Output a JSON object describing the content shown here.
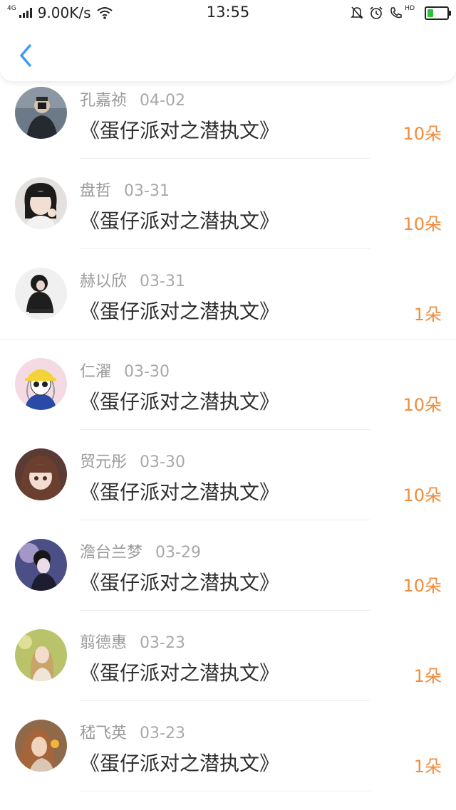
{
  "status_bar": {
    "network": "4G",
    "speed": "9.00K/s",
    "time": "13:55",
    "icons": [
      "signal-icon",
      "wifi-icon",
      "mute-bell-icon",
      "alarm-icon",
      "hd-call-icon",
      "battery-charging-icon"
    ],
    "hd_label": "HD"
  },
  "header": {
    "back_icon": "chevron-left-icon",
    "accent_color": "#3a9bf0"
  },
  "gift_records": [
    {
      "name": "孔嘉祯",
      "date": "04-02",
      "title": "《蛋仔派对之潜执文》",
      "count": "10朵"
    },
    {
      "name": "盘哲",
      "date": "03-31",
      "title": "《蛋仔派对之潜执文》",
      "count": "10朵"
    },
    {
      "name": "赫以欣",
      "date": "03-31",
      "title": "《蛋仔派对之潜执文》",
      "count": "1朵"
    },
    {
      "name": "仁濯",
      "date": "03-30",
      "title": "《蛋仔派对之潜执文》",
      "count": "10朵"
    },
    {
      "name": "贸元彤",
      "date": "03-30",
      "title": "《蛋仔派对之潜执文》",
      "count": "10朵"
    },
    {
      "name": "澹台兰梦",
      "date": "03-29",
      "title": "《蛋仔派对之潜执文》",
      "count": "10朵"
    },
    {
      "name": "翦德惠",
      "date": "03-23",
      "title": "《蛋仔派对之潜执文》",
      "count": "1朵"
    },
    {
      "name": "嵇飞英",
      "date": "03-23",
      "title": "《蛋仔派对之潜执文》",
      "count": "1朵"
    }
  ],
  "colors": {
    "name_gray": "#9a9a9a",
    "count_orange": "#f08c3c",
    "title_dark": "#2f2f2f"
  }
}
